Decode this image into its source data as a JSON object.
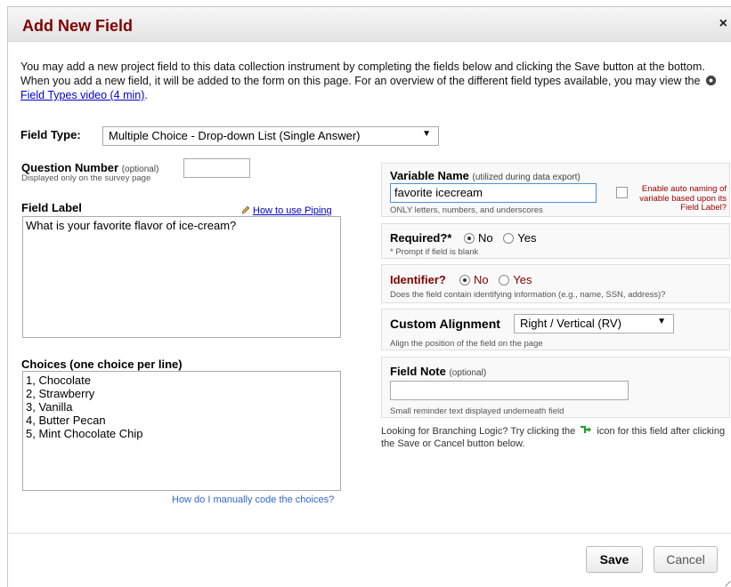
{
  "dialog": {
    "title": "Add New Field",
    "close_glyph": "×"
  },
  "intro": {
    "text_before": "You may add a new project field to this data collection instrument by completing the fields below and clicking the Save button at the bottom. When you add a new field, it will be added to the form on this page. For an overview of the different field types available, you may view the",
    "video_link": "Field Types video (4 min)",
    "text_after": "."
  },
  "field_type": {
    "label": "Field Type:",
    "selected": "Multiple Choice - Drop-down List (Single Answer)",
    "arrow": "▼"
  },
  "question_number": {
    "label": "Question Number",
    "optional": "(optional)",
    "hint": "Displayed only on the survey page",
    "value": ""
  },
  "field_label": {
    "label": "Field Label",
    "piping_link": "How to use Piping",
    "value": "What is your favorite flavor of ice-cream?"
  },
  "choices": {
    "label": "Choices (one choice per line)",
    "value": "1, Chocolate\n2, Strawberry\n3, Vanilla\n4, Butter Pecan\n5, Mint Chocolate Chip",
    "manual_code_link": "How do I manually code the choices?"
  },
  "variable_name": {
    "label": "Variable Name",
    "utilized": "(utilized during data export)",
    "value": "favorite icecream",
    "hint": "ONLY letters, numbers, and underscores",
    "auto_naming_label": "Enable auto naming of variable based upon its Field Label?"
  },
  "required": {
    "label": "Required?*",
    "no": "No",
    "yes": "Yes",
    "hint": "* Prompt if field is blank"
  },
  "identifier": {
    "label": "Identifier?",
    "no": "No",
    "yes": "Yes",
    "hint": "Does the field contain identifying information (e.g., name, SSN, address)?"
  },
  "custom_alignment": {
    "label": "Custom Alignment",
    "selected": "Right / Vertical (RV)",
    "arrow": "▼",
    "hint": "Align the position of the field on the page"
  },
  "field_note": {
    "label": "Field Note",
    "optional": "(optional)",
    "value": "",
    "hint": "Small reminder text displayed underneath field"
  },
  "branching": {
    "text_before": "Looking for Branching Logic? Try clicking the",
    "text_after": "icon for this field after clicking the Save or Cancel button below."
  },
  "buttons": {
    "save": "Save",
    "cancel": "Cancel"
  },
  "colors": {
    "title": "#800000",
    "identifier_label": "#800000",
    "auto_naming": "#a00000",
    "link": "#0000cc"
  }
}
